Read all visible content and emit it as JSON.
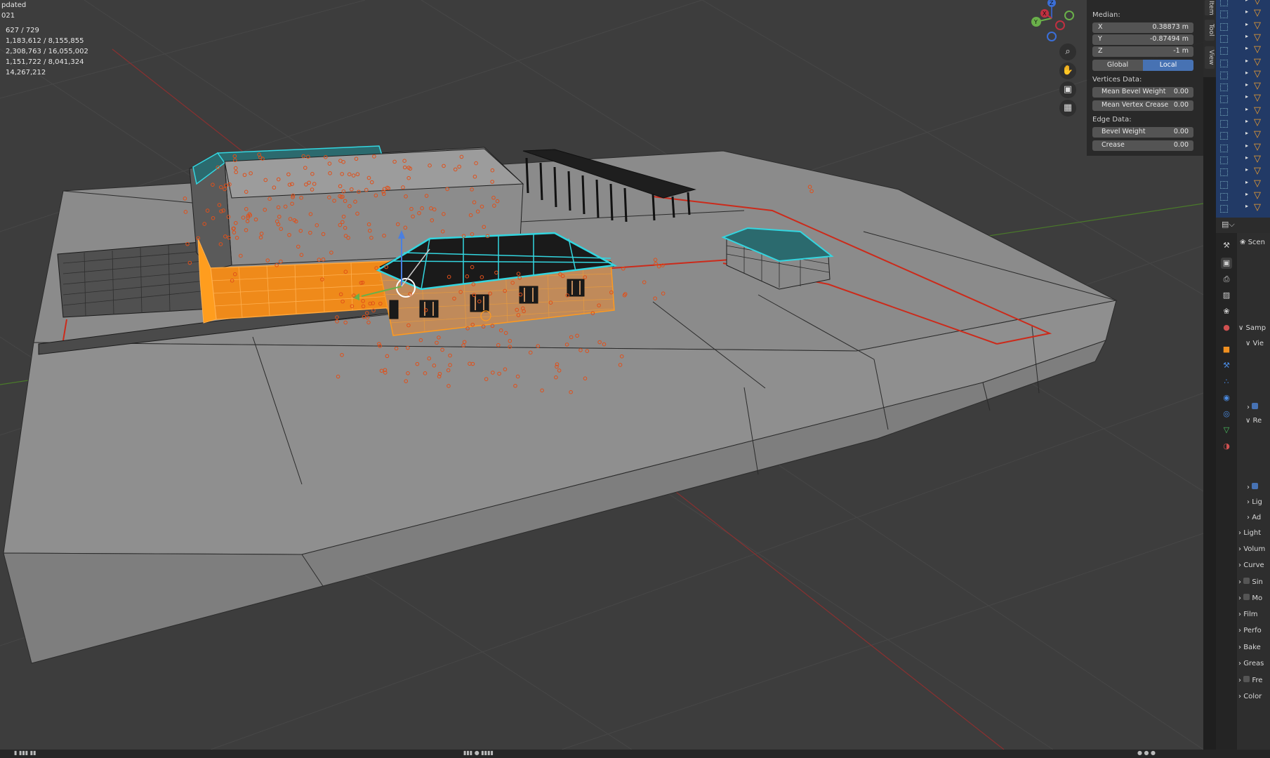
{
  "viewport": {
    "stats": {
      "title": "pdated",
      "year": "021",
      "rows": [
        "627 / 729",
        "1,183,612 / 8,155,855",
        "2,308,763 / 16,055,002",
        "1,151,722 / 8,041,324",
        "14,267,212"
      ]
    },
    "gizmo": {
      "axes": [
        "X",
        "Y",
        "Z"
      ]
    },
    "nav_icons": [
      "zoom-icon",
      "pan-hand-icon",
      "camera-icon",
      "grid-icon"
    ]
  },
  "npanel": {
    "median_label": "Median:",
    "x": {
      "label": "X",
      "value": "0.38873 m"
    },
    "y": {
      "label": "Y",
      "value": "-0.87494 m"
    },
    "z": {
      "label": "Z",
      "value": "-1 m"
    },
    "global_label": "Global",
    "local_label": "Local",
    "vertices_label": "Vertices Data:",
    "mean_bevel": {
      "label": "Mean Bevel Weight",
      "value": "0.00"
    },
    "mean_crease": {
      "label": "Mean Vertex Crease",
      "value": "0.00"
    },
    "edge_label": "Edge Data:",
    "bevel": {
      "label": "Bevel Weight",
      "value": "0.00"
    },
    "crease": {
      "label": "Crease",
      "value": "0.00"
    },
    "active_color": "#4772b3"
  },
  "vtabs": {
    "item": "Item",
    "tool": "Tool",
    "view": "View"
  },
  "properties": {
    "scene_label": "Scen",
    "rows": [
      "Samp",
      "Vie",
      "Re",
      "Lig",
      "Ad",
      "Light",
      "Volum",
      "Curve",
      "Sin",
      "Mo",
      "Film",
      "Perfo",
      "Bake",
      "Greas",
      "Fre",
      "Color"
    ]
  },
  "colors": {
    "selection_orange": "#ff9a1e",
    "edge_cyan": "#33d6e0",
    "seam_red": "#cc2a1a",
    "panel_blue": "#4772b3"
  }
}
